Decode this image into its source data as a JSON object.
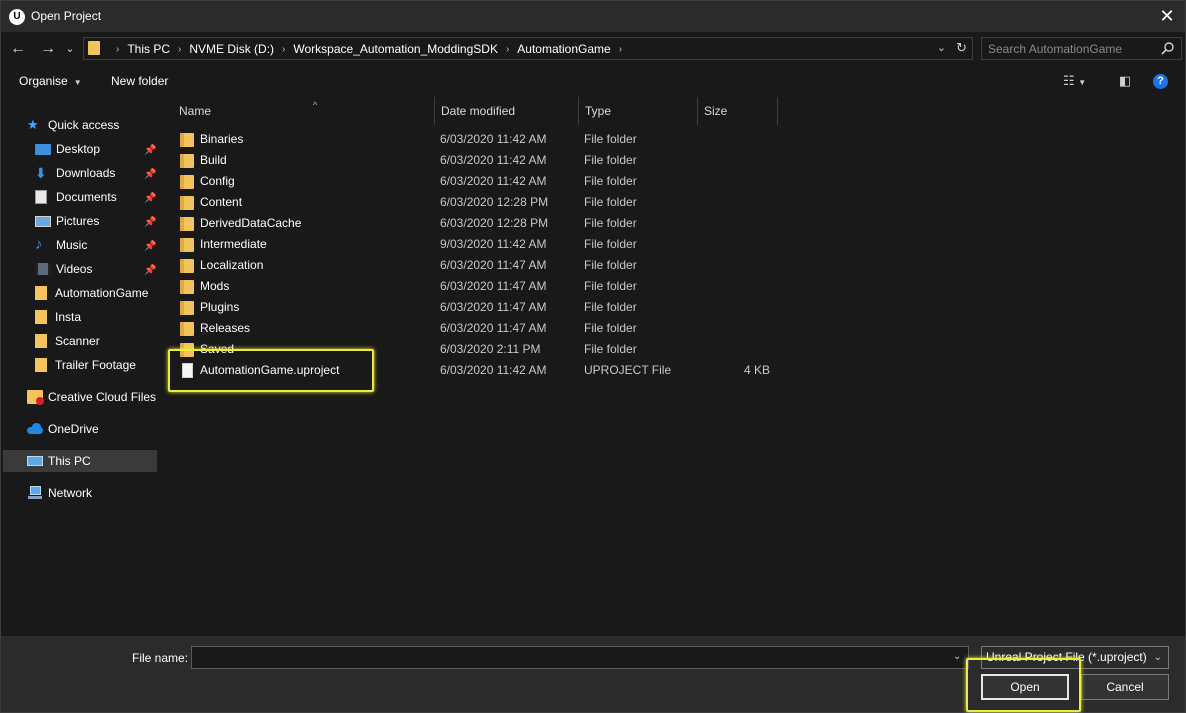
{
  "window": {
    "title": "Open Project",
    "app_icon_glyph": "U",
    "close_glyph": "✕"
  },
  "nav": {
    "back_glyph": "←",
    "forward_glyph": "→",
    "recent_glyph": "⌄",
    "up_glyph": "↑",
    "breadcrumbs": [
      "This PC",
      "NVME Disk (D:)",
      "Workspace_Automation_ModdingSDK",
      "AutomationGame"
    ],
    "search_placeholder": "Search AutomationGame"
  },
  "toolbar": {
    "organise_label": "Organise",
    "new_folder_label": "New folder"
  },
  "sidebar": {
    "quick_access": "Quick access",
    "items": [
      {
        "label": "Desktop",
        "icon": "desktop-icon",
        "pinned": true
      },
      {
        "label": "Downloads",
        "icon": "download-icon",
        "pinned": true
      },
      {
        "label": "Documents",
        "icon": "documents-icon",
        "pinned": true
      },
      {
        "label": "Pictures",
        "icon": "pictures-icon",
        "pinned": true
      },
      {
        "label": "Music",
        "icon": "music-icon",
        "pinned": true
      },
      {
        "label": "Videos",
        "icon": "videos-icon",
        "pinned": true
      },
      {
        "label": "AutomationGame",
        "icon": "folder-icon",
        "pinned": false
      },
      {
        "label": "Insta",
        "icon": "folder-icon",
        "pinned": false
      },
      {
        "label": "Scanner",
        "icon": "folder-icon",
        "pinned": false
      },
      {
        "label": "Trailer Footage",
        "icon": "folder-icon",
        "pinned": false
      }
    ],
    "creative_cloud": "Creative Cloud Files",
    "onedrive": "OneDrive",
    "this_pc": "This PC",
    "network": "Network"
  },
  "columns": {
    "name": "Name",
    "date": "Date modified",
    "type": "Type",
    "size": "Size"
  },
  "files": [
    {
      "name": "Binaries",
      "date": "6/03/2020 11:42 AM",
      "type": "File folder",
      "size": "",
      "kind": "folder"
    },
    {
      "name": "Build",
      "date": "6/03/2020 11:42 AM",
      "type": "File folder",
      "size": "",
      "kind": "folder"
    },
    {
      "name": "Config",
      "date": "6/03/2020 11:42 AM",
      "type": "File folder",
      "size": "",
      "kind": "folder"
    },
    {
      "name": "Content",
      "date": "6/03/2020 12:28 PM",
      "type": "File folder",
      "size": "",
      "kind": "folder"
    },
    {
      "name": "DerivedDataCache",
      "date": "6/03/2020 12:28 PM",
      "type": "File folder",
      "size": "",
      "kind": "folder"
    },
    {
      "name": "Intermediate",
      "date": "9/03/2020 11:42 AM",
      "type": "File folder",
      "size": "",
      "kind": "folder"
    },
    {
      "name": "Localization",
      "date": "6/03/2020 11:47 AM",
      "type": "File folder",
      "size": "",
      "kind": "folder"
    },
    {
      "name": "Mods",
      "date": "6/03/2020 11:47 AM",
      "type": "File folder",
      "size": "",
      "kind": "folder"
    },
    {
      "name": "Plugins",
      "date": "6/03/2020 11:47 AM",
      "type": "File folder",
      "size": "",
      "kind": "folder"
    },
    {
      "name": "Releases",
      "date": "6/03/2020 11:47 AM",
      "type": "File folder",
      "size": "",
      "kind": "folder"
    },
    {
      "name": "Saved",
      "date": "6/03/2020 2:11 PM",
      "type": "File folder",
      "size": "",
      "kind": "folder"
    },
    {
      "name": "AutomationGame.uproject",
      "date": "6/03/2020 11:42 AM",
      "type": "UPROJECT File",
      "size": "4 KB",
      "kind": "file"
    }
  ],
  "footer": {
    "file_name_label": "File name:",
    "file_name_value": "",
    "filter": "Unreal Project File (*.uproject)",
    "open_label": "Open",
    "cancel_label": "Cancel"
  },
  "colors": {
    "highlight": "#ecec3e",
    "folder": "#f2c55c",
    "accent": "#1a73e8"
  }
}
